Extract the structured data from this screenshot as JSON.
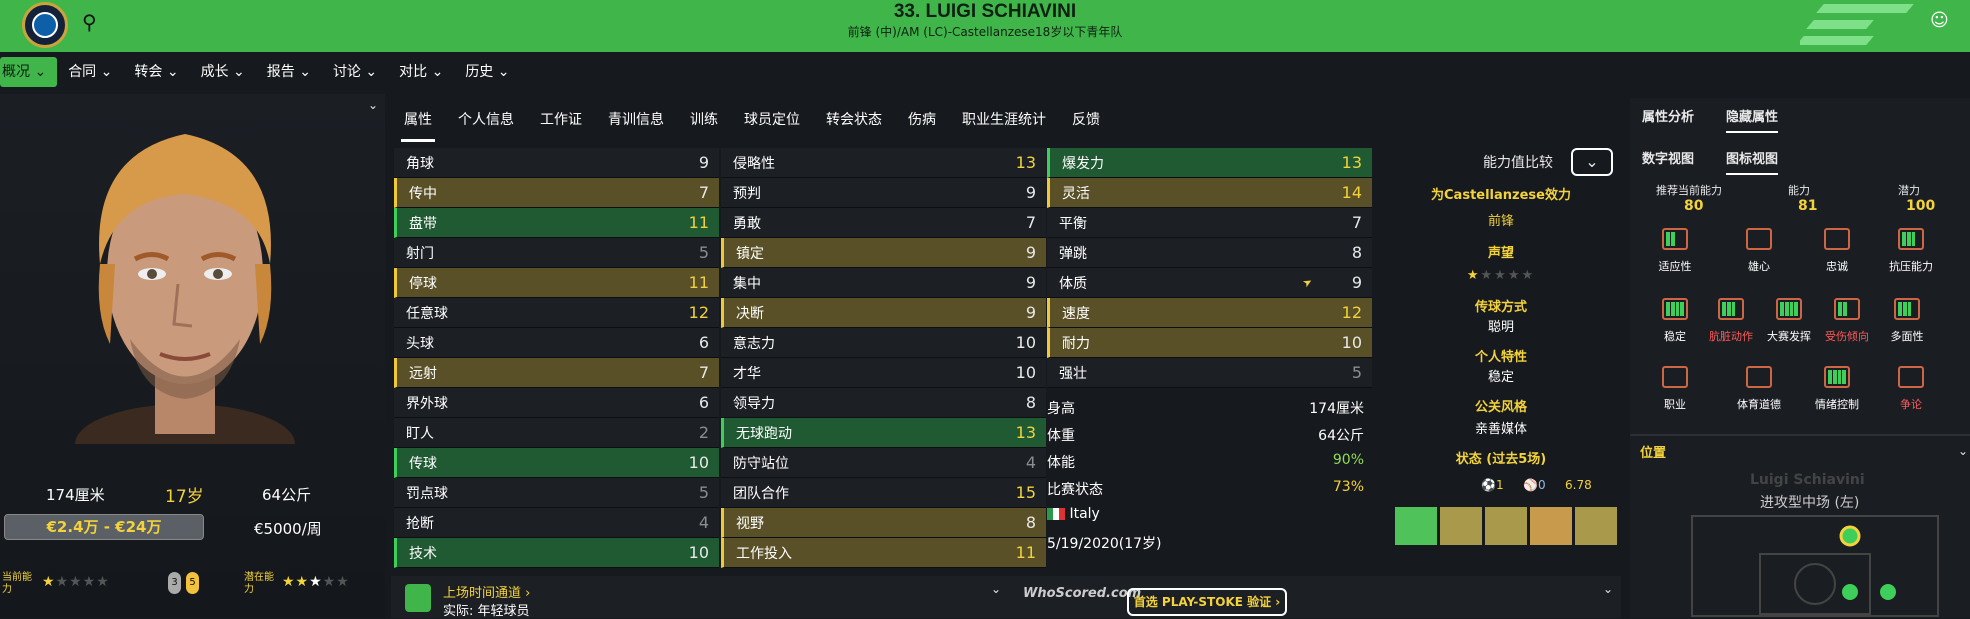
{
  "header": {
    "title": "33. LUIGI SCHIAVINI",
    "subtitle": "前锋 (中)/AM (LC)-Castellanzese18岁以下青年队"
  },
  "nav": {
    "items": [
      "概况",
      "合同",
      "转会",
      "成长",
      "报告",
      "讨论",
      "对比",
      "历史"
    ]
  },
  "left": {
    "height": "174厘米",
    "age": "17岁",
    "weight": "64公斤",
    "value_range": "€2.4万 - €24万",
    "wage": "€5000/周",
    "current_ability_label": "当前能力",
    "potential_ability_label": "潜在能力",
    "ca_stars": 1,
    "pa_stars": 2.5,
    "pill_a": "3",
    "pill_b": "5"
  },
  "tabs": [
    "属性",
    "个人信息",
    "工作证",
    "青训信息",
    "训练",
    "球员定位",
    "转会状态",
    "伤病",
    "职业生涯统计",
    "反馈"
  ],
  "attributes": {
    "technical": [
      {
        "name": "角球",
        "value": "9",
        "style": "dark",
        "color": "w"
      },
      {
        "name": "传中",
        "value": "7",
        "style": "gold",
        "color": "w"
      },
      {
        "name": "盘带",
        "value": "11",
        "style": "green",
        "color": "y"
      },
      {
        "name": "射门",
        "value": "5",
        "style": "dark",
        "color": "gr"
      },
      {
        "name": "停球",
        "value": "11",
        "style": "gold",
        "color": "y"
      },
      {
        "name": "任意球",
        "value": "12",
        "style": "dark",
        "color": "y"
      },
      {
        "name": "头球",
        "value": "6",
        "style": "dark",
        "color": "w"
      },
      {
        "name": "远射",
        "value": "7",
        "style": "gold",
        "color": "w"
      },
      {
        "name": "界外球",
        "value": "6",
        "style": "dark",
        "color": "w"
      },
      {
        "name": "盯人",
        "value": "2",
        "style": "dark",
        "color": "gr"
      },
      {
        "name": "传球",
        "value": "10",
        "style": "green",
        "color": "w"
      },
      {
        "name": "罚点球",
        "value": "5",
        "style": "dark",
        "color": "gr"
      },
      {
        "name": "抢断",
        "value": "4",
        "style": "dark",
        "color": "gr"
      },
      {
        "name": "技术",
        "value": "10",
        "style": "green",
        "color": "w"
      }
    ],
    "mental": [
      {
        "name": "侵略性",
        "value": "13",
        "style": "dark",
        "color": "y"
      },
      {
        "name": "预判",
        "value": "9",
        "style": "dark",
        "color": "w"
      },
      {
        "name": "勇敢",
        "value": "7",
        "style": "dark",
        "color": "w"
      },
      {
        "name": "镇定",
        "value": "9",
        "style": "gold",
        "color": "w"
      },
      {
        "name": "集中",
        "value": "9",
        "style": "dark",
        "color": "w"
      },
      {
        "name": "决断",
        "value": "9",
        "style": "gold",
        "color": "w"
      },
      {
        "name": "意志力",
        "value": "10",
        "style": "dark",
        "color": "w"
      },
      {
        "name": "才华",
        "value": "10",
        "style": "dark",
        "color": "w"
      },
      {
        "name": "领导力",
        "value": "8",
        "style": "dark",
        "color": "w"
      },
      {
        "name": "无球跑动",
        "value": "13",
        "style": "green",
        "color": "y"
      },
      {
        "name": "防守站位",
        "value": "4",
        "style": "dark",
        "color": "gr"
      },
      {
        "name": "团队合作",
        "value": "15",
        "style": "dark",
        "color": "y"
      },
      {
        "name": "视野",
        "value": "8",
        "style": "gold",
        "color": "w"
      },
      {
        "name": "工作投入",
        "value": "11",
        "style": "gold",
        "color": "y"
      }
    ],
    "physical": [
      {
        "name": "爆发力",
        "value": "13",
        "style": "green",
        "color": "y"
      },
      {
        "name": "灵活",
        "value": "14",
        "style": "gold",
        "color": "y"
      },
      {
        "name": "平衡",
        "value": "7",
        "style": "dark",
        "color": "w"
      },
      {
        "name": "弹跳",
        "value": "8",
        "style": "dark",
        "color": "w"
      },
      {
        "name": "体质",
        "value": "9",
        "style": "dark",
        "color": "w"
      },
      {
        "name": "速度",
        "value": "12",
        "style": "gold",
        "color": "y"
      },
      {
        "name": "耐力",
        "value": "10",
        "style": "gold",
        "color": "w"
      },
      {
        "name": "强壮",
        "value": "5",
        "style": "dark",
        "color": "gr"
      }
    ]
  },
  "info": [
    {
      "label": "身高",
      "value": "174厘米"
    },
    {
      "label": "体重",
      "value": "64公斤"
    },
    {
      "label": "体能",
      "value": "90%"
    },
    {
      "label": "比赛状态",
      "value": "73%"
    }
  ],
  "nation": "Italy",
  "dob": "5/19/2020(17岁)",
  "compare": {
    "label": "能力值比较",
    "for_club": "为Castellanzese效力",
    "position": "前锋",
    "reputation_label": "声望",
    "reputation_stars": 0.5,
    "passing_style_label": "传球方式",
    "passing_style": "聪明",
    "personality_label": "个人特性",
    "personality": "稳定",
    "media_label": "公关风格",
    "media": "亲善媒体",
    "form_label": "状态 (过去5场)",
    "goals": "1",
    "assists": "0",
    "rating": "6.78",
    "form_bars": [
      "#4fc25a",
      "#a89a4a",
      "#a89a4a",
      "#c79a4c",
      "#a89a4a"
    ]
  },
  "footer": {
    "playtime": "上场时间通道",
    "playtime_sub": "实际: 年轻球员",
    "whoscored": "WhoScored.com",
    "playstoke": "首选 PLAY-STOKE 验证"
  },
  "right": {
    "tabs": [
      "属性分析",
      "隐藏属性"
    ],
    "view_tabs": [
      "数字视图",
      "图标视图"
    ],
    "ability_labels": [
      "推荐当前能力",
      "能力",
      "潜力"
    ],
    "ability_values": [
      "80",
      "81",
      "100"
    ],
    "hidden": [
      "适应性",
      "雄心",
      "忠诚",
      "抗压能力",
      "稳定",
      "肮脏动作",
      "大赛发挥",
      "受伤倾向",
      "多面性",
      "职业",
      "体育道德",
      "情绪控制",
      "争论"
    ],
    "position_title": "位置",
    "player_name": "Luigi Schiavini",
    "role": "进攻型中场 (左)"
  }
}
